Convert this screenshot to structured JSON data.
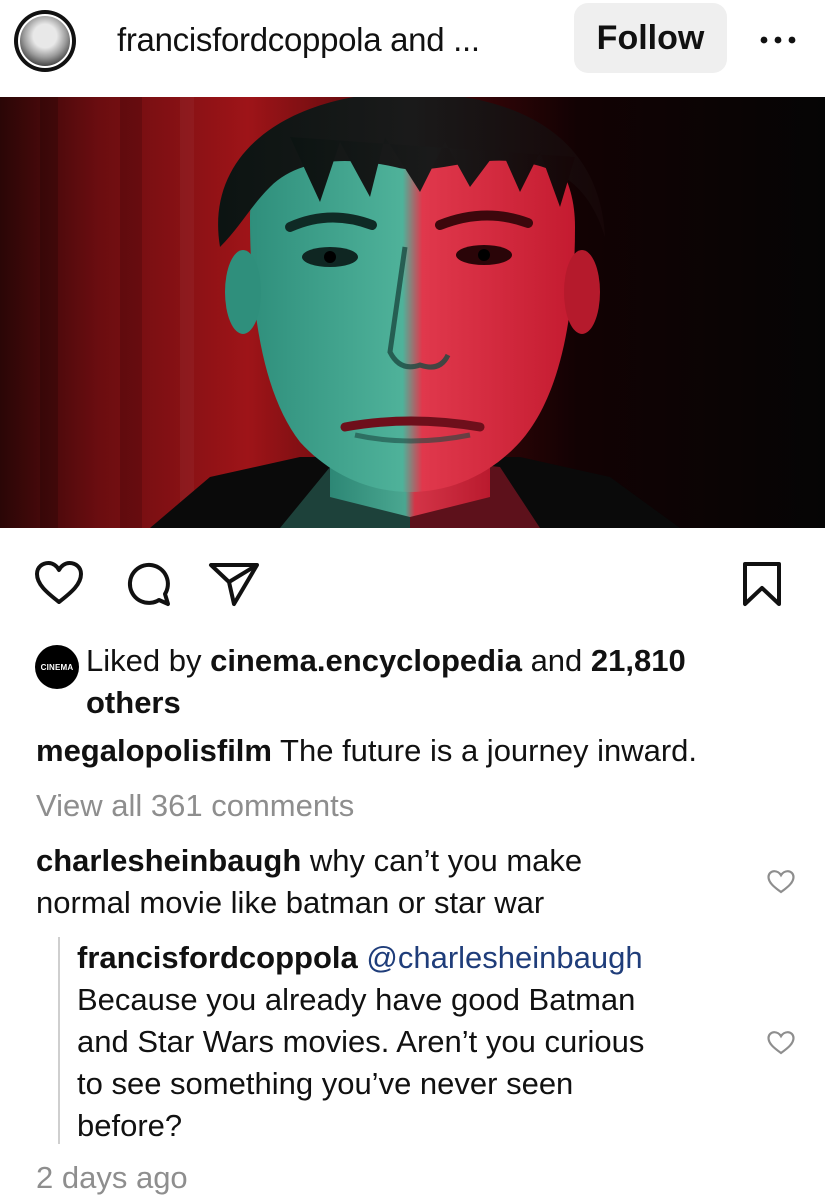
{
  "header": {
    "username": "francisfordcoppola and ...",
    "follow_label": "Follow",
    "more_icon": "more-horizontal-icon"
  },
  "post": {
    "image_description_icon": "post-image"
  },
  "actions": {
    "like_icon": "heart-icon",
    "comment_icon": "comment-icon",
    "share_icon": "send-icon",
    "save_icon": "bookmark-icon"
  },
  "likes": {
    "badge_text": "CINEMA",
    "prefix": "Liked by ",
    "user": "cinema.encyclopedia",
    "middle": " and ",
    "count": "21,810",
    "suffix": "others"
  },
  "caption": {
    "user": "megalopolisfilm",
    "text": " The future is a journey inward."
  },
  "view_comments": "View all 361 comments",
  "comments": [
    {
      "user": "charlesheinbaugh",
      "line1": " why can’t you make",
      "line2": "normal movie like batman or star war"
    }
  ],
  "reply": {
    "user": "francisfordcoppola",
    "mention": " @charlesheinbaugh",
    "line1": "Because you already have good Batman",
    "line2": "and Star Wars movies. Aren’t you curious",
    "line3": "to see something you’ve never seen",
    "line4": "before?"
  },
  "timestamp": "2 days ago"
}
